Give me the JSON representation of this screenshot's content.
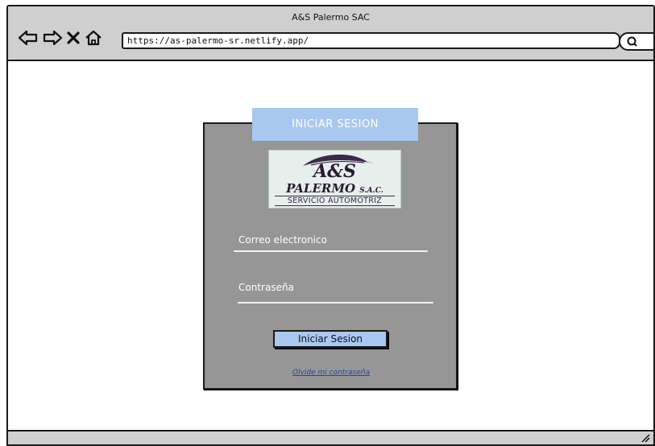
{
  "window": {
    "title": "A&S Palermo SAC"
  },
  "browser": {
    "url": "https://as-palermo-sr.netlify.app/"
  },
  "login": {
    "tab_title": "INICIAR SESION",
    "logo": {
      "line1": "A&S",
      "line2": "PALERMO",
      "line2_suffix": "S.A.C.",
      "line3": "SERVICIO AUTOMOTRIZ"
    },
    "email_label": "Correo electronico",
    "password_label": "Contraseña",
    "submit_label": "Iniciar Sesion",
    "forgot_link": "Olvide mi contraseña"
  },
  "colors": {
    "accent": "#a8c8f0",
    "card_bg": "#969696",
    "chrome": "#cfcfcf",
    "link": "#1a4aa0"
  }
}
